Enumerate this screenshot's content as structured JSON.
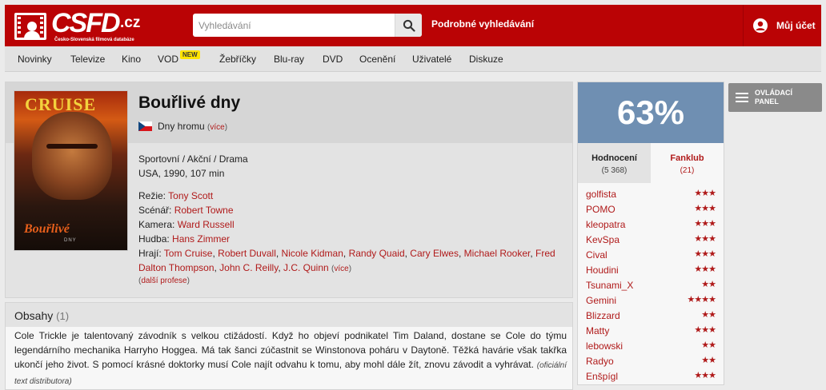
{
  "header": {
    "logo_text": "CSFD",
    "logo_tld": ".cz",
    "logo_subtitle": "Česko-Slovenská filmová databáze",
    "search_placeholder": "Vyhledávání",
    "advanced_search": "Podrobné vyhledávání",
    "account": "Můj účet",
    "brand_color": "#ba0305"
  },
  "nav": {
    "items": [
      "Novinky",
      "Televize",
      "Kino",
      "VOD",
      "Žebříčky",
      "Blu-ray",
      "DVD",
      "Ocenění",
      "Uživatelé",
      "Diskuze"
    ],
    "vod_badge": "NEW"
  },
  "film": {
    "title": "Bouřlivé dny",
    "original_title": "Dny hromu",
    "more": "více",
    "genres": "Sportovní / Akční / Drama",
    "origin": "USA, 1990, 107 min",
    "poster": {
      "title": "CRUISE",
      "logo": "Bouřlivé",
      "sub": "DNY"
    },
    "labels": {
      "director": "Režie:",
      "writer": "Scénář:",
      "camera": "Kamera:",
      "music": "Hudba:",
      "cast": "Hrají:"
    },
    "director": "Tony Scott",
    "writer": "Robert Towne",
    "camera": "Ward Russell",
    "music": "Hans Zimmer",
    "cast": [
      "Tom Cruise",
      "Robert Duvall",
      "Nicole Kidman",
      "Randy Quaid",
      "Cary Elwes",
      "Michael Rooker",
      "Fred Dalton Thompson",
      "John C. Reilly",
      "J.C. Quinn"
    ],
    "more_professions": "další profese"
  },
  "plot": {
    "heading": "Obsahy",
    "count": "(1)",
    "text": "Cole Trickle je talentovaný závodník s velkou ctižádostí. Když ho objeví podnikatel Tim Daland, dostane se Cole do týmu legendárního mechanika Harryho Hoggea. Má tak šanci zúčastnit se Winstonova poháru v Daytoně. Těžká havárie však takřka ukončí jeho život. S pomocí krásné doktorky musí Cole najít odvahu k tomu, aby mohl dále žít, znovu závodit a vyhrávat.",
    "source": "(oficiální text distributora)"
  },
  "rating": {
    "percent": "63%",
    "color": "#6f8fb2",
    "tab1_label": "Hodnocení",
    "tab1_count": "(5 368)",
    "tab2_label": "Fanklub",
    "tab2_count": "(21)",
    "users": [
      {
        "name": "golfista",
        "stars": 3
      },
      {
        "name": "POMO",
        "stars": 3
      },
      {
        "name": "kleopatra",
        "stars": 3
      },
      {
        "name": "KevSpa",
        "stars": 3
      },
      {
        "name": "Cival",
        "stars": 3
      },
      {
        "name": "Houdini",
        "stars": 3
      },
      {
        "name": "Tsunami_X",
        "stars": 2
      },
      {
        "name": "Gemini",
        "stars": 4
      },
      {
        "name": "Blizzard",
        "stars": 2
      },
      {
        "name": "Matty",
        "stars": 3
      },
      {
        "name": "lebowski",
        "stars": 2
      },
      {
        "name": "Radyo",
        "stars": 2
      },
      {
        "name": "Enšpígl",
        "stars": 3
      }
    ]
  },
  "control_panel": {
    "line1": "OVLÁDACÍ",
    "line2": "PANEL"
  }
}
